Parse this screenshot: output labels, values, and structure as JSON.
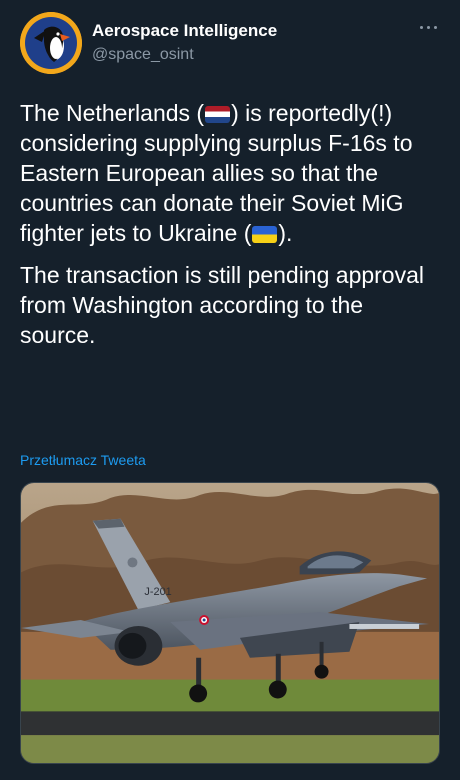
{
  "author": {
    "display_name": "Aerospace Intelligence",
    "handle": "@space_osint"
  },
  "tweet": {
    "line1_before_flag": "The Netherlands (",
    "line1_after_flag": ") is reportedly(!) considering supplying surplus F-16s to Eastern European allies so that the countries can donate their Soviet MiG fighter jets to Ukraine (",
    "line1_end": ").",
    "paragraph2": "The transaction is still pending approval from Washington according to the source."
  },
  "translate_label": "Przetłumacz Tweeta",
  "image": {
    "tail_code": "J-201"
  },
  "colors": {
    "background": "#15202b",
    "link": "#1d9bf0",
    "secondary_text": "#8b98a5"
  }
}
